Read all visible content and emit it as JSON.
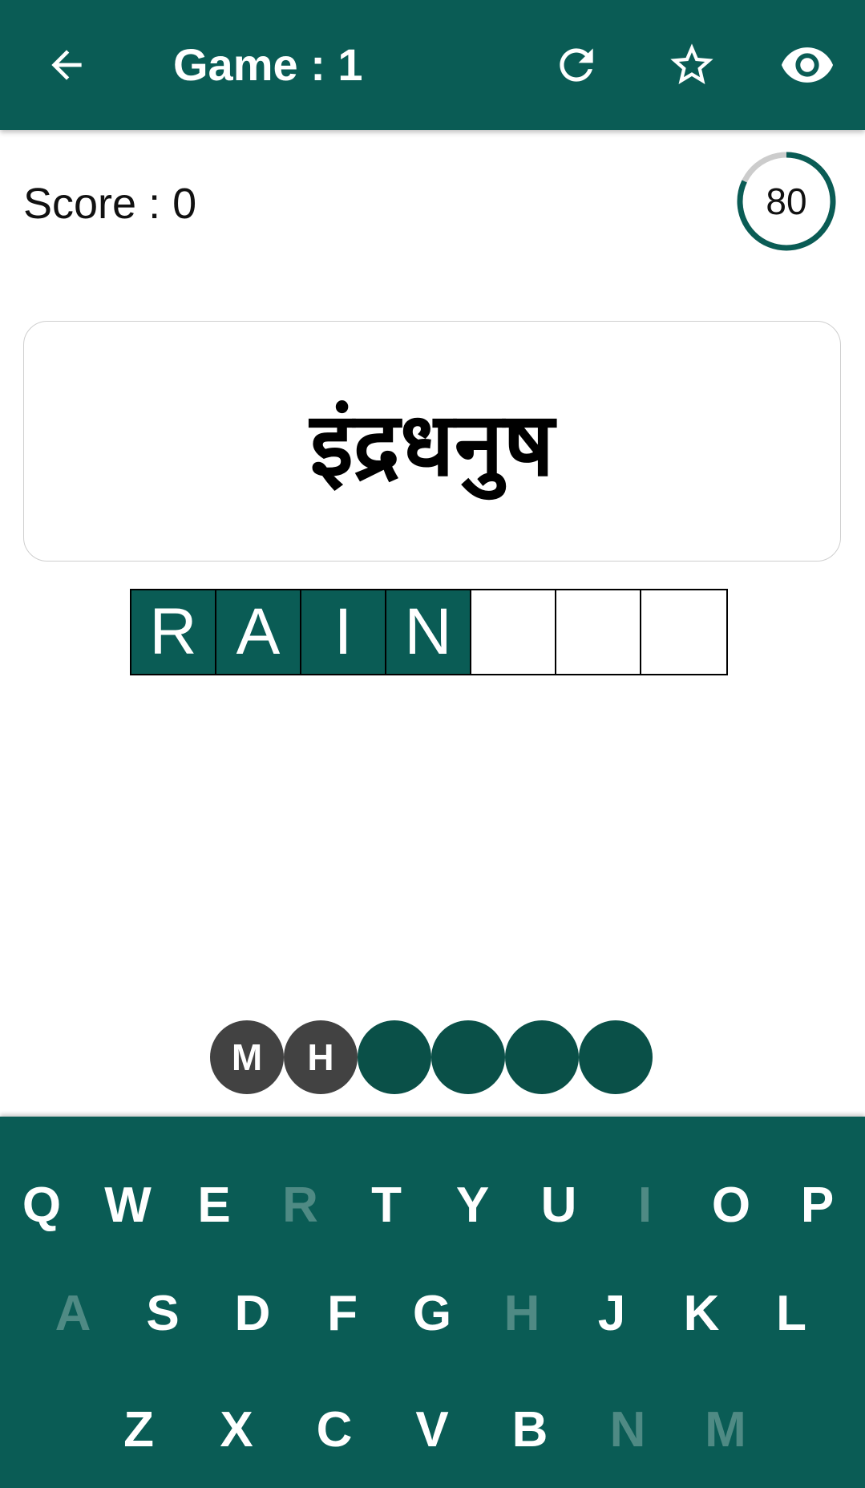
{
  "appbar": {
    "title": "Game : 1",
    "back_icon": "arrow-back-icon",
    "refresh_icon": "refresh-icon",
    "star_icon": "star-outline-icon",
    "eye_icon": "eye-icon"
  },
  "score": {
    "label": "Score : 0"
  },
  "timer": {
    "value": "80",
    "progress_fraction": 0.82
  },
  "word": {
    "text": "इंद्रधनुष"
  },
  "answer": {
    "tiles": [
      {
        "letter": "R",
        "state": "filled"
      },
      {
        "letter": "A",
        "state": "filled"
      },
      {
        "letter": "I",
        "state": "filled"
      },
      {
        "letter": "N",
        "state": "filled"
      },
      {
        "letter": "",
        "state": "empty"
      },
      {
        "letter": "",
        "state": "empty"
      },
      {
        "letter": "",
        "state": "empty"
      }
    ]
  },
  "hints": [
    {
      "label": "M",
      "state": "used"
    },
    {
      "label": "H",
      "state": "used"
    },
    {
      "label": "",
      "state": "open"
    },
    {
      "label": "",
      "state": "open"
    },
    {
      "label": "",
      "state": "open"
    },
    {
      "label": "",
      "state": "open"
    }
  ],
  "keyboard": {
    "rows": [
      [
        "Q",
        "W",
        "E",
        "R",
        "T",
        "Y",
        "U",
        "I",
        "O",
        "P"
      ],
      [
        "A",
        "S",
        "D",
        "F",
        "G",
        "H",
        "J",
        "K",
        "L"
      ],
      [
        "Z",
        "X",
        "C",
        "V",
        "B",
        "N",
        "M"
      ]
    ],
    "used_keys": [
      "R",
      "I",
      "A",
      "H",
      "N",
      "M"
    ]
  },
  "colors": {
    "primary": "#0a5c55",
    "used_key": "#4f8a84",
    "hint_used": "#424242",
    "timer_track": "#cccccc"
  }
}
